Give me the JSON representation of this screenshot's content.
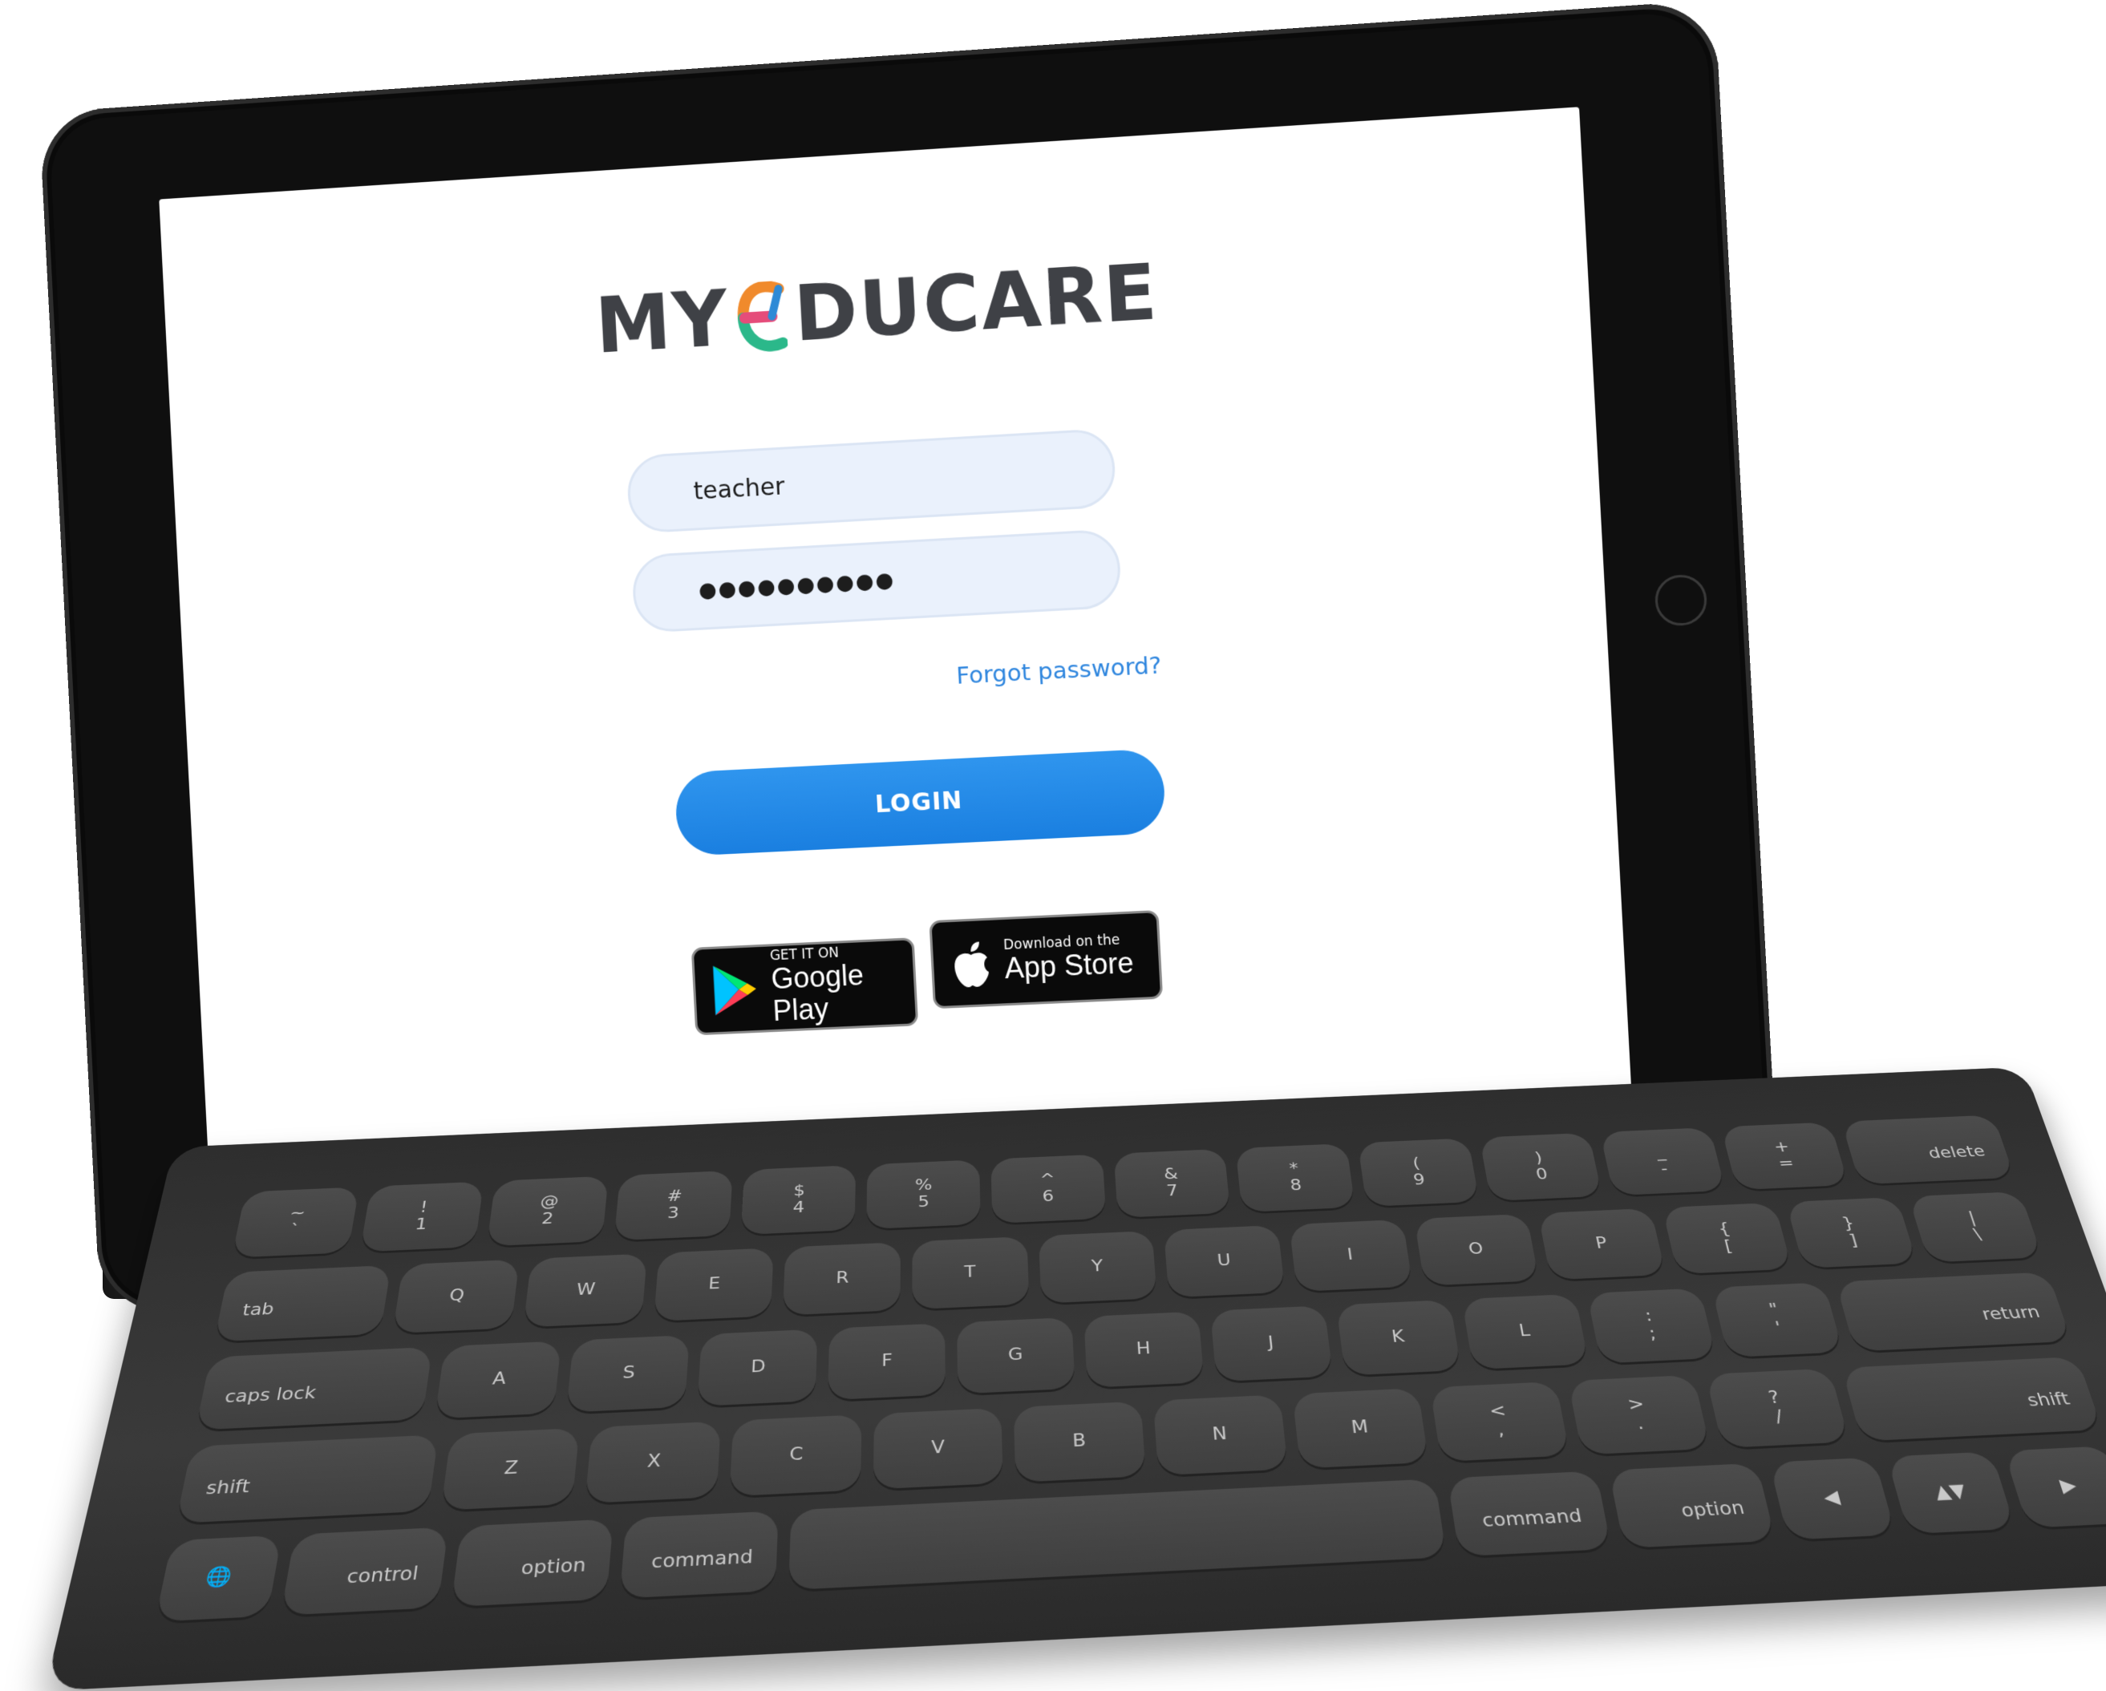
{
  "app": {
    "brand": "MYEDUCARE",
    "brand_parts": {
      "left": "MY",
      "right": "DUCARE"
    },
    "colors": {
      "brand_text": "#3f4146",
      "e_orange": "#f08a2c",
      "e_pink": "#e54c7a",
      "e_blue": "#2d8ad6",
      "e_green": "#2bb88a",
      "field_bg": "#eaf1fc",
      "primary": "#1f86e6",
      "link": "#2f86de"
    }
  },
  "login": {
    "username_value": "teacher",
    "password_value": "●●●●●●●●●●",
    "forgot_label": "Forgot password?",
    "submit_label": "LOGIN"
  },
  "stores": {
    "google": {
      "small": "GET IT ON",
      "big": "Google Play",
      "icon": "google-play-icon"
    },
    "apple": {
      "small": "Download on the",
      "big": "App Store",
      "icon": "apple-icon"
    }
  },
  "keyboard": {
    "rows": [
      [
        "~\n`",
        "!\n1",
        "@\n2",
        "#\n3",
        "$\n4",
        "%\n5",
        "^\n6",
        "&\n7",
        "*\n8",
        "(\n9",
        ")\n0",
        "_\n-",
        "+\n=",
        "delete"
      ],
      [
        "tab",
        "Q",
        "W",
        "E",
        "R",
        "T",
        "Y",
        "U",
        "I",
        "O",
        "P",
        "{\n[",
        "}\n]",
        "|\n\\"
      ],
      [
        "caps lock",
        "A",
        "S",
        "D",
        "F",
        "G",
        "H",
        "J",
        "K",
        "L",
        ":\n;",
        "\"\n'",
        "return"
      ],
      [
        "shift",
        "Z",
        "X",
        "C",
        "V",
        "B",
        "N",
        "M",
        "<\n,",
        ">\n.",
        "?\n/",
        "shift"
      ],
      [
        "🌐",
        "control",
        "option",
        "command",
        "",
        "command",
        "option",
        "◀",
        "▲▼",
        "▶"
      ]
    ]
  }
}
